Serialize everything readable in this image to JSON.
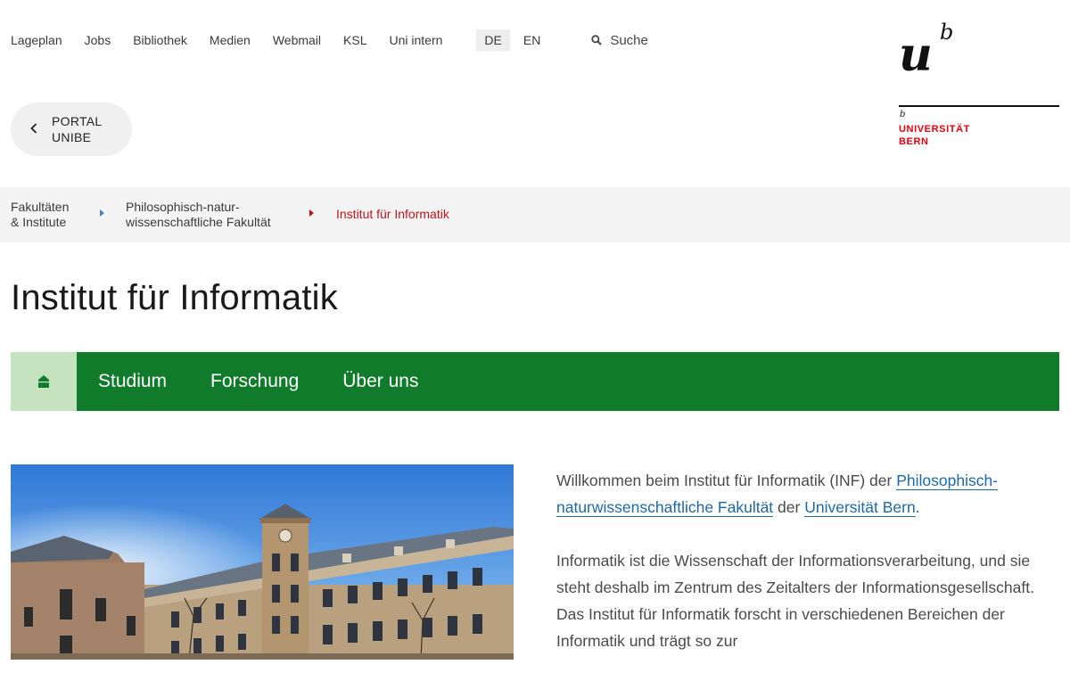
{
  "topnav": {
    "links": [
      "Lageplan",
      "Jobs",
      "Bibliothek",
      "Medien",
      "Webmail",
      "KSL",
      "Uni intern"
    ],
    "languages": [
      {
        "label": "DE",
        "active": true
      },
      {
        "label": "EN",
        "active": false
      }
    ],
    "search_label": "Suche"
  },
  "logo": {
    "u": "u",
    "b": "b",
    "small_b": "b",
    "line1": "UNIVERSITÄT",
    "line2": "BERN",
    "accent": "#e3000f"
  },
  "portal": {
    "line1": "PORTAL",
    "line2": "UNIBE"
  },
  "breadcrumb": {
    "items": [
      {
        "line1": "Fakultäten",
        "line2": "& Institute"
      },
      {
        "line1": "Philosophisch-natur-",
        "line2": "wissenschaftliche Fakultät"
      }
    ],
    "current": "Institut für Informatik"
  },
  "page_title": "Institut für Informatik",
  "mainnav": {
    "color": "#107b2a",
    "items": [
      "Studium",
      "Forschung",
      "Über uns"
    ]
  },
  "intro": {
    "p1_a": "Willkommen beim Institut für Informatik (INF) der ",
    "p1_link1": "Philosophisch-naturwissenschaftliche Fakultät",
    "p1_b": " der ",
    "p1_link2": "Universität Bern",
    "p1_c": ".",
    "p2": "Informatik ist die Wissenschaft der Informationsverarbeitung, und sie steht deshalb im Zentrum des Zeitalters der Informationsgesellschaft. Das Institut für Informatik forscht in verschiedenen Bereichen der Informatik und trägt so zur"
  }
}
